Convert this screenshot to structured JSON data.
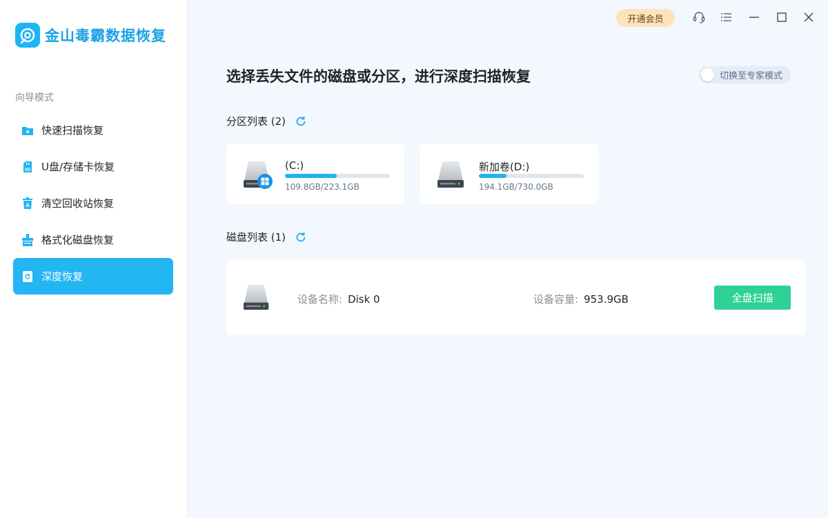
{
  "app": {
    "name": "金山毒霸数据恢复"
  },
  "colors": {
    "accent": "#24b5f3",
    "scan_button": "#2fd195",
    "vip": "#fde3bc"
  },
  "header": {
    "vip_label": "开通会员",
    "icons": [
      "headset-icon",
      "menu-icon",
      "minimize-icon",
      "maximize-icon",
      "close-icon"
    ]
  },
  "sidebar": {
    "section_label": "向导模式",
    "items": [
      {
        "label": "快速扫描恢复",
        "icon": "quick-scan-icon",
        "active": false
      },
      {
        "label": "U盘/存储卡恢复",
        "icon": "usb-card-icon",
        "active": false
      },
      {
        "label": "清空回收站恢复",
        "icon": "recycle-bin-icon",
        "active": false
      },
      {
        "label": "格式化磁盘恢复",
        "icon": "format-disk-icon",
        "active": false
      },
      {
        "label": "深度恢复",
        "icon": "deep-recovery-icon",
        "active": true
      }
    ]
  },
  "main": {
    "title": "选择丢失文件的磁盘或分区，进行深度扫描恢复",
    "expert_toggle_label": "切换至专家模式",
    "partitions_heading": "分区列表 (2)",
    "partitions": [
      {
        "name": "(C:)",
        "size_text": "109.8GB/223.1GB",
        "used_fraction": 0.492,
        "system": true
      },
      {
        "name": "新加卷(D:)",
        "size_text": "194.1GB/730.0GB",
        "used_fraction": 0.266,
        "system": false
      }
    ],
    "disks_heading": "磁盘列表 (1)",
    "disks": [
      {
        "name_key": "设备名称:",
        "name": "Disk 0",
        "capacity_key": "设备容量:",
        "capacity": "953.9GB",
        "scan_label": "全盘扫描"
      }
    ]
  }
}
